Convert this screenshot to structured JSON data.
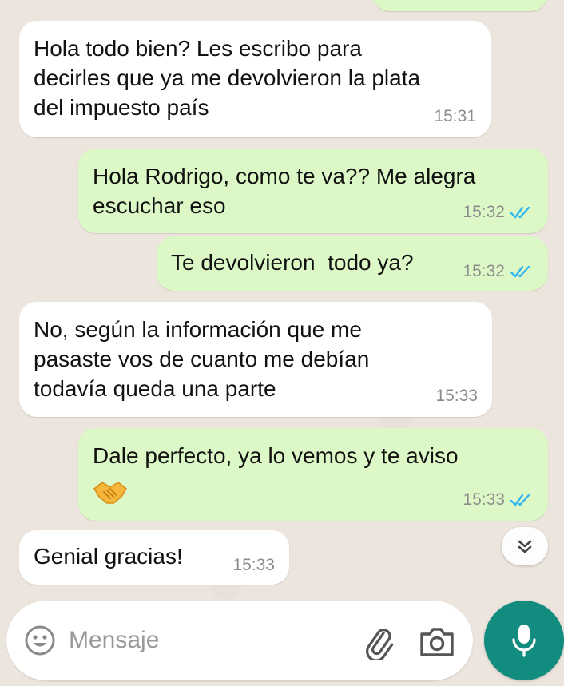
{
  "colors": {
    "incoming_bubble": "#ffffff",
    "outgoing_bubble": "#dcf8c6",
    "read_ticks": "#34b7f1",
    "mic_button": "#128c7e"
  },
  "messages": [
    {
      "direction": "incoming",
      "text": "Hola todo bien? Les escribo para\ndecirles que ya me devolvieron la plata\ndel impuesto país",
      "time": "15:31"
    },
    {
      "direction": "outgoing",
      "text": "Hola Rodrigo, como te va?? Me alegra\nescuchar eso",
      "time": "15:32",
      "status": "read"
    },
    {
      "direction": "outgoing",
      "text": "Te devolvieron  todo ya?",
      "time": "15:32",
      "status": "read"
    },
    {
      "direction": "incoming",
      "text": "No, según la información que me\npasaste vos de cuanto me debían\ntodavía queda una parte",
      "time": "15:33"
    },
    {
      "direction": "outgoing",
      "text": "Dale perfecto, ya lo vemos y te aviso",
      "emoji": "handshake-emoji",
      "time": "15:33",
      "status": "read"
    },
    {
      "direction": "incoming",
      "text": "Genial gracias!",
      "time": "15:33"
    }
  ],
  "scroll_button": {
    "icon": "double-chevron-down-icon"
  },
  "composer": {
    "placeholder": "Mensaje",
    "value": "",
    "icons": [
      "emoji-icon",
      "attach-icon",
      "camera-icon",
      "mic-icon"
    ]
  }
}
